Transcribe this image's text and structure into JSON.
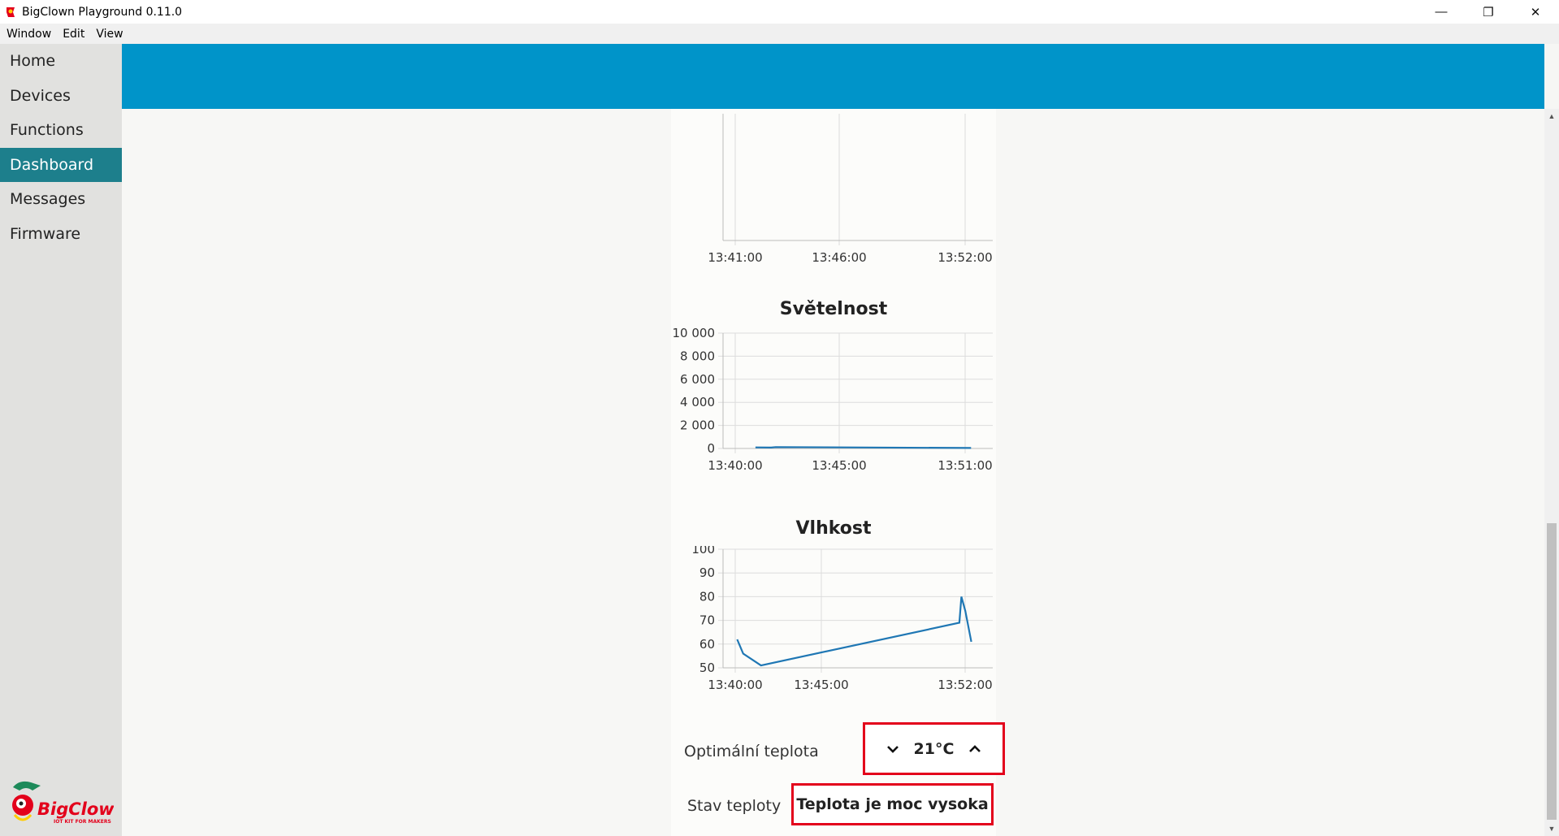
{
  "window": {
    "title": "BigClown Playground 0.11.0",
    "minimize": "—",
    "maximize": "❐",
    "close": "✕"
  },
  "menu": [
    "Window",
    "Edit",
    "View"
  ],
  "sidebar": {
    "items": [
      {
        "label": "Home",
        "active": false
      },
      {
        "label": "Devices",
        "active": false
      },
      {
        "label": "Functions",
        "active": false
      },
      {
        "label": "Dashboard",
        "active": true
      },
      {
        "label": "Messages",
        "active": false
      },
      {
        "label": "Firmware",
        "active": false
      }
    ],
    "logo_text": "BigClown",
    "logo_sub": "IOT KIT FOR MAKERS"
  },
  "colors": {
    "accent": "#0094c9",
    "active_nav": "#1d7f8c",
    "line": "#1f77b4",
    "alert": "#e3001b"
  },
  "chart_data": [
    {
      "type": "line",
      "title": "",
      "x_ticks": [
        "13:41:00",
        "13:46:00",
        "13:52:00"
      ],
      "x": [],
      "series": [
        {
          "values": []
        }
      ],
      "grid": true
    },
    {
      "type": "line",
      "title": "Světelnost",
      "x_ticks": [
        "13:40:00",
        "13:45:00",
        "13:51:00"
      ],
      "y_ticks": [
        "10 000",
        "8 000",
        "6 000",
        "4 000",
        "2 000",
        "0"
      ],
      "ylim": [
        0,
        10000
      ],
      "xlim_min": [
        0,
        11.5
      ],
      "x_min": [
        0.9,
        1.6,
        1.8,
        10.5
      ],
      "series": [
        {
          "values": [
            90,
            75,
            120,
            40
          ]
        }
      ],
      "grid": true
    },
    {
      "type": "line",
      "title": "Vlhkost",
      "x_ticks": [
        "13:40:00",
        "13:45:00",
        "13:52:00"
      ],
      "y_ticks": [
        "100",
        "90",
        "80",
        "70",
        "60",
        "50"
      ],
      "ylim": [
        50,
        100
      ],
      "xlim_min": [
        0,
        12
      ],
      "x_min": [
        0.1,
        0.4,
        1.3,
        11.3,
        11.4,
        11.6,
        11.9
      ],
      "series": [
        {
          "values": [
            62,
            56,
            51,
            69,
            80,
            74,
            61
          ]
        }
      ],
      "grid": true
    }
  ],
  "controls": {
    "optimal_label": "Optimální teplota",
    "optimal_value": "21°C",
    "status_label": "Stav teploty",
    "status_value": "Teplota je moc vysoka"
  }
}
